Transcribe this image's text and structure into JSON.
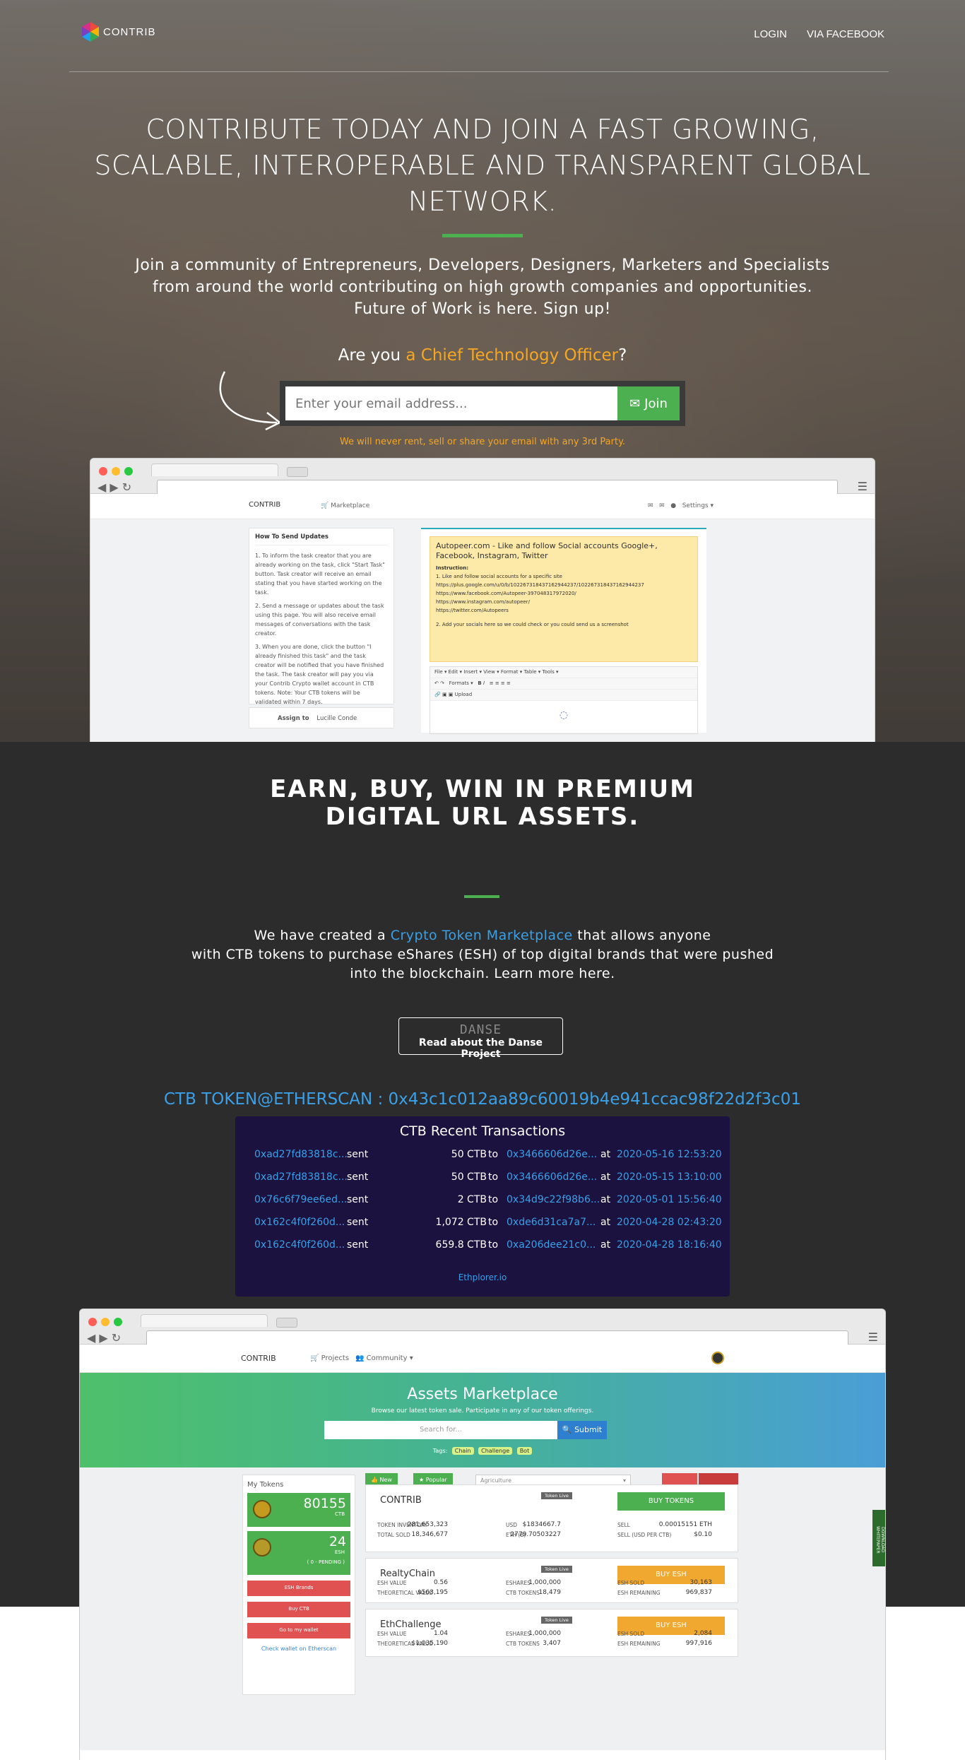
{
  "brand": {
    "name": "CONTRIB"
  },
  "nav": {
    "login": "LOGIN",
    "facebook": "VIA FACEBOOK"
  },
  "hero": {
    "title_line1": "CONTRIBUTE TODAY AND JOIN A FAST GROWING,",
    "title_line2": "SCALABLE, INTEROPERABLE AND TRANSPARENT GLOBAL",
    "title_line3": "NETWORK.",
    "sub_line1": "Join a community of Entrepreneurs, Developers, Designers, Marketers and Specialists",
    "sub_line2": "from around the world contributing on high growth companies and opportunities.",
    "sub_line3": "Future of Work is here. Sign up!",
    "question_prefix": "Are you",
    "question_role": "a Chief Technology Officer",
    "question_suffix": "?",
    "email_placeholder": "Enter your email address...",
    "join_label": "Join",
    "privacy_note": "We will never rent, sell or share your email with any 3rd Party."
  },
  "mock1": {
    "logo": "CONTRIB",
    "nav_marketplace": "Marketplace",
    "nav_settings": "Settings",
    "left_title": "How To Send Updates",
    "step1": "1. To inform the task creator that you are already working on the task, click \"Start Task\" button. Task creator will receive an email stating that you have started working on the task.",
    "step2": "2. Send a message or updates about the task using this page. You will also receive email messages of conversations with the task creator.",
    "step3": "3. When you are done, click the button \"I already finished this task\" and the task creator will be notified that you have finished the task. The task creator will pay you via your Contrib Crypto wallet account in CTB tokens. Note: Your CTB tokens will be validated within 7 days.",
    "assign_label": "Assign to",
    "assign_value": "Lucille Conde",
    "card_title": "Autopeer.com - Like and follow Social accounts Google+, Facebook, Instagram, Twitter",
    "card_instruction": "Instruction:",
    "card_step1": "1. Like and follow social accounts for a specific site",
    "card_link1": "https://plus.google.com/u/0/b/102267318437162944237/102267318437162944237",
    "card_link2": "https://www.facebook.com/Autopeer-397048317972020/",
    "card_link3": "https://www.instagram.com/autopeer/",
    "card_link4": "https://twitter.com/Autopeers",
    "card_step2": "2. Add your socials here so we could check or you could send us a screenshot",
    "editor_menu": "File ▾   Edit ▾   Insert ▾   View ▾   Format ▾   Table ▾   Tools ▾",
    "editor_formats": "Formats ▾",
    "editor_upload": "Upload"
  },
  "premium": {
    "title_line1": "EARN, BUY, WIN IN PREMIUM",
    "title_line2": "DIGITAL URL ASSETS.",
    "sub_prefix": "We have created a",
    "sub_link": "Crypto Token Marketplace",
    "sub_suffix": "that allows anyone",
    "sub_line2": "with CTB tokens to purchase eShares (ESH) of top digital brands that were pushed",
    "sub_line3": "into the blockchain. Learn more here.",
    "danse_logo": "DANSE",
    "danse_button": "Read about the Danse Project",
    "etherscan": "CTB TOKEN@ETHERSCAN : 0x43c1c012aa89c60019b4e941ccac98f22d2f3c01"
  },
  "transactions": {
    "title": "CTB Recent Transactions",
    "rows": [
      {
        "from": "0xad27fd83818c...",
        "verb": "sent",
        "amount": "50 CTB",
        "to": "to",
        "dest": "0x3466606d26e...",
        "at": "at",
        "time": "2020-05-16 12:53:20"
      },
      {
        "from": "0xad27fd83818c...",
        "verb": "sent",
        "amount": "50 CTB",
        "to": "to",
        "dest": "0x3466606d26e...",
        "at": "at",
        "time": "2020-05-15 13:10:00"
      },
      {
        "from": "0x76c6f79ee6ed...",
        "verb": "sent",
        "amount": "2 CTB",
        "to": "to",
        "dest": "0x34d9c22f98b6...",
        "at": "at",
        "time": "2020-05-01 15:56:40"
      },
      {
        "from": "0x162c4f0f260d...",
        "verb": "sent",
        "amount": "1,072 CTB",
        "to": "to",
        "dest": "0xde6d31ca7a7...",
        "at": "at",
        "time": "2020-04-28 02:43:20"
      },
      {
        "from": "0x162c4f0f260d...",
        "verb": "sent",
        "amount": "659.8 CTB",
        "to": "to",
        "dest": "0xa206dee21c0...",
        "at": "at",
        "time": "2020-04-28 18:16:40"
      }
    ],
    "footer": "Ethplorer.io"
  },
  "mock2": {
    "logo": "CONTRIB",
    "nav_projects": "Projects",
    "nav_community": "Community",
    "hero_title": "Assets Marketplace",
    "hero_sub": "Browse our latest token sale. Participate in any of our token offerings.",
    "search_placeholder": "Search for...",
    "search_button": "Submit",
    "tags_label": "Tags:",
    "tags": [
      "Chain",
      "Challenge",
      "Bot"
    ],
    "my_tokens": "My Tokens",
    "ctb_amount": "80155",
    "ctb_unit": "CTB",
    "esh_amount": "24",
    "esh_unit": "ESH",
    "esh_pending": "( 0 - PENDING )",
    "esh_brands": "ESH Brands",
    "buy_ctb": "Buy CTB",
    "go_wallet": "Go to my wallet",
    "check_wallet": "Check wallet on Etherscan",
    "filter_new": "New",
    "filter_popular": "Popular",
    "filter_category": "Agriculture",
    "side_tab": "DOWNLOAD WHITEPAPER",
    "cards": [
      {
        "name": "CONTRIB",
        "badge": "Token Live",
        "cta": "BUY TOKENS",
        "l1": "TOKEN INVENTORY",
        "v1": "281,653,323",
        "l2": "USD",
        "v2": "$1834667.7",
        "l3": "SELL",
        "v3": "0.00015151 ETH",
        "l4": "TOTAL SOLD",
        "v4": "18,346,677",
        "l5": "ETH (B)",
        "v5": "2779.70503227",
        "l6": "SELL (USD PER CTB)",
        "v6": "$0.10"
      },
      {
        "name": "RealtyChain",
        "badge": "Token Live",
        "cta": "BUY ESH",
        "l1": "ESH VALUE",
        "v1": "0.56",
        "l2": "ESHARES",
        "v2": "1,000,000",
        "l3": "ESH SOLD",
        "v3": "30,163",
        "l4": "THEORETICAL VALUE",
        "v4": "$563,195",
        "l5": "CTB TOKENS",
        "v5": "18,479",
        "l6": "ESH REMAINING",
        "v6": "969,837"
      },
      {
        "name": "EthChallenge",
        "badge": "Token Live",
        "cta": "BUY ESH",
        "l1": "ESH VALUE",
        "v1": "1.04",
        "l2": "ESHARES",
        "v2": "1,000,000",
        "l3": "ESH SOLD",
        "v3": "2,084",
        "l4": "THEORETICAL VALUE",
        "v4": "$1,035,190",
        "l5": "CTB TOKENS",
        "v5": "3,407",
        "l6": "ESH REMAINING",
        "v6": "997,916"
      }
    ]
  },
  "colors": {
    "accent_green": "#4caf50",
    "accent_orange": "#f5a623",
    "link_blue": "#3aa0e8",
    "dark_bg": "#2c2c2c",
    "tx_bg": "#1b1240"
  }
}
